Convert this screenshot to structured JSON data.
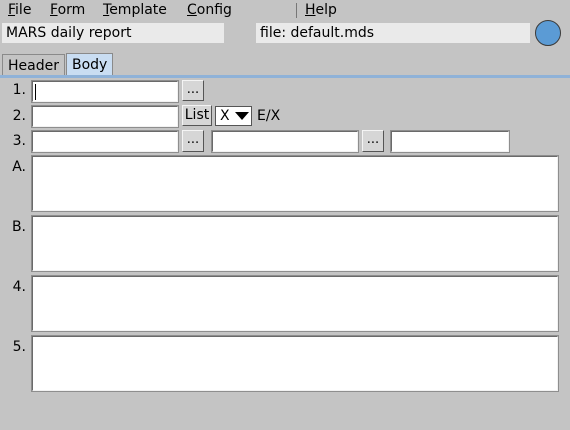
{
  "menu": {
    "file": {
      "underline": "F",
      "rest": "ile"
    },
    "form": {
      "underline": "F",
      "rest": "orm"
    },
    "template": {
      "underline": "T",
      "rest": "emplate"
    },
    "config": {
      "underline": "C",
      "rest": "onfig"
    },
    "help": {
      "underline": "H",
      "rest": "elp"
    }
  },
  "header": {
    "report_title": "MARS daily report",
    "file_label": "file: default.mds",
    "status_color": "#5b9bd5"
  },
  "tabs": [
    {
      "label": "Header",
      "active": false
    },
    {
      "label": "Body",
      "active": true
    }
  ],
  "body": {
    "row1": {
      "label": "1.",
      "value": "",
      "browse_label": "..."
    },
    "row2": {
      "label": "2.",
      "value": "",
      "list_label": "List",
      "select_value": "X",
      "suffix": "E/X"
    },
    "row3": {
      "label": "3.",
      "value1": "",
      "browse1_label": "...",
      "value2": "",
      "browse2_label": "...",
      "value3": ""
    },
    "areas": [
      {
        "label": "A.",
        "value": ""
      },
      {
        "label": "B.",
        "value": ""
      },
      {
        "label": "4.",
        "value": ""
      },
      {
        "label": "5.",
        "value": ""
      }
    ]
  }
}
